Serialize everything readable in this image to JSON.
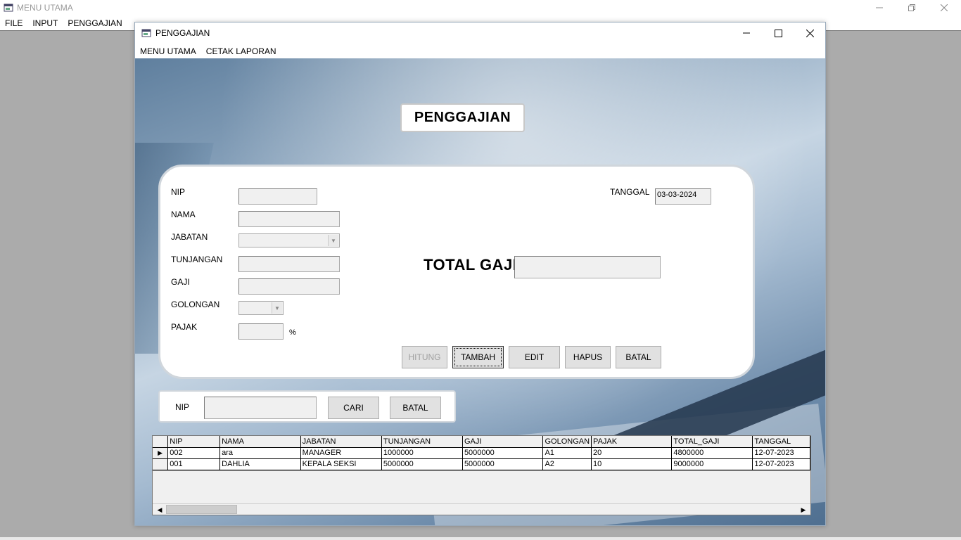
{
  "outer_window": {
    "title": "MENU UTAMA",
    "menu": [
      "FILE",
      "INPUT",
      "PENGGAJIAN"
    ]
  },
  "child_window": {
    "title": "PENGGAJIAN",
    "menu": [
      "MENU UTAMA",
      "CETAK LAPORAN"
    ]
  },
  "form": {
    "heading": "PENGGAJIAN",
    "labels": {
      "nip": "NIP",
      "nama": "NAMA",
      "jabatan": "JABATAN",
      "tunjangan": "TUNJANGAN",
      "gaji": "GAJI",
      "golongan": "GOLONGAN",
      "pajak": "PAJAK",
      "percent": "%",
      "tanggal": "TANGGAL",
      "total_gaji": "TOTAL GAJI"
    },
    "values": {
      "nip": "",
      "nama": "",
      "jabatan": "",
      "tunjangan": "",
      "gaji": "",
      "golongan": "",
      "pajak": "",
      "tanggal": "03-03-2024",
      "total_gaji": ""
    },
    "buttons": {
      "hitung": "HITUNG",
      "tambah": "TAMBAH",
      "edit": "EDIT",
      "hapus": "HAPUS",
      "batal": "BATAL"
    }
  },
  "search": {
    "label": "NIP",
    "value": "",
    "cari": "CARI",
    "batal": "BATAL"
  },
  "grid": {
    "columns": [
      "NIP",
      "NAMA",
      "JABATAN",
      "TUNJANGAN",
      "GAJI",
      "GOLONGAN",
      "PAJAK",
      "TOTAL_GAJI",
      "TANGGAL"
    ],
    "rows": [
      [
        "002",
        "ara",
        "MANAGER",
        "1000000",
        "5000000",
        "A1",
        "20",
        "4800000",
        "12-07-2023"
      ],
      [
        "001",
        "DAHLIA",
        "KEPALA SEKSI",
        "5000000",
        "5000000",
        "A2",
        "10",
        "9000000",
        "12-07-2023"
      ]
    ],
    "selected_row": 0
  },
  "icons": {
    "minimize": "minimize-icon",
    "maximize": "maximize-icon",
    "restore": "restore-icon",
    "close": "close-icon",
    "app": "app-window-icon",
    "row_pointer": "row-pointer-icon",
    "dropdown": "chevron-down-icon",
    "scroll_left": "scroll-left-icon",
    "scroll_right": "scroll-right-icon"
  }
}
